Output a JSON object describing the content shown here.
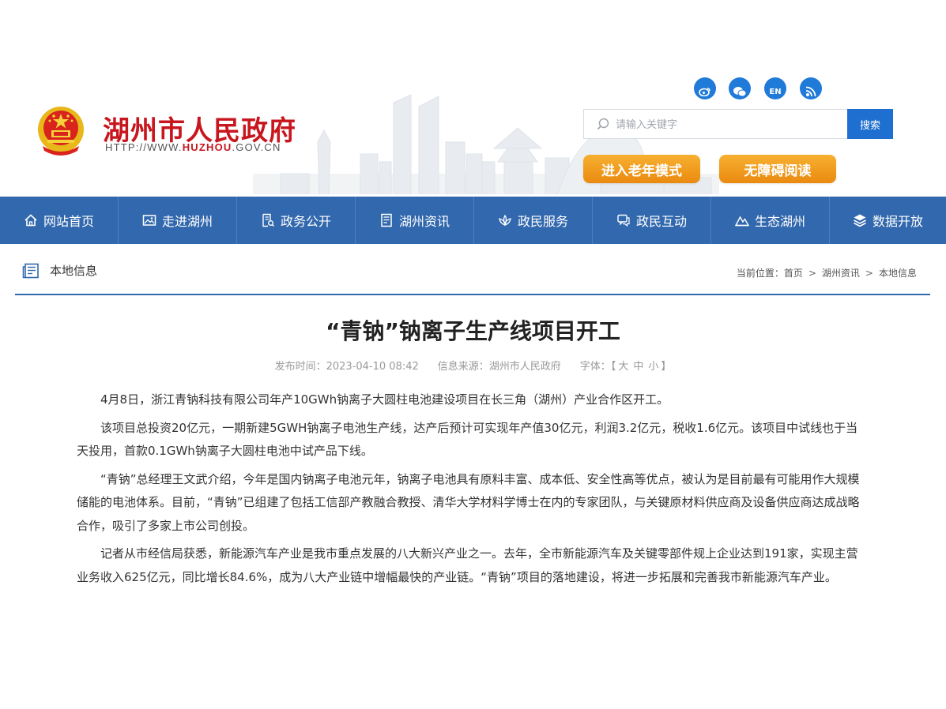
{
  "header": {
    "site_title": "湖州市人民政府",
    "url_prefix": "HTTP://WWW.",
    "url_domain": "HUZHOU",
    "url_suffix": ".GOV.CN",
    "social_icons": [
      "weibo-icon",
      "wechat-icon",
      "en-icon",
      "rss-icon"
    ],
    "en_label": "EN",
    "search": {
      "placeholder": "请输入关键字",
      "value": "",
      "button_label": "搜索"
    },
    "elder_mode_label": "进入老年模式",
    "accessible_label": "无障碍阅读",
    "colors": {
      "brand_red": "#c8161e",
      "accent_orange": "#f29a1f",
      "search_blue": "#1e6fd0"
    }
  },
  "nav": {
    "background": "#3268ad",
    "items": [
      {
        "label": "网站首页",
        "icon": "home-icon"
      },
      {
        "label": "走进湖州",
        "icon": "image-icon"
      },
      {
        "label": "政务公开",
        "icon": "document-search-icon"
      },
      {
        "label": "湖州资讯",
        "icon": "news-icon"
      },
      {
        "label": "政民服务",
        "icon": "lotus-icon"
      },
      {
        "label": "政民互动",
        "icon": "chat-icon"
      },
      {
        "label": "生态湖州",
        "icon": "mountain-icon"
      },
      {
        "label": "数据开放",
        "icon": "layers-icon"
      }
    ]
  },
  "section": {
    "title": "本地信息",
    "breadcrumb_label": "当前位置：",
    "breadcrumb": [
      "首页",
      "湖州资讯",
      "本地信息"
    ],
    "breadcrumb_sep": ">"
  },
  "article": {
    "title": "“青钠”钠离子生产线项目开工",
    "publish_label": "发布时间：",
    "publish_time": "2023-04-10 08:42",
    "source_label": "信息来源：",
    "source": "湖州市人民政府",
    "font_label": "字体：",
    "font_open": "【",
    "font_large": "大",
    "font_medium": "中",
    "font_small": "小",
    "font_close": "】",
    "paragraphs": [
      "4月8日，浙江青钠科技有限公司年产10GWh钠离子大圆柱电池建设项目在长三角（湖州）产业合作区开工。",
      "该项目总投资20亿元，一期新建5GWH钠离子电池生产线，达产后预计可实现年产值30亿元，利润3.2亿元，税收1.6亿元。该项目中试线也于当天投用，首款0.1GWh钠离子大圆柱电池中试产品下线。",
      "“青钠”总经理王文武介绍，今年是国内钠离子电池元年，钠离子电池具有原料丰富、成本低、安全性高等优点，被认为是目前最有可能用作大规模储能的电池体系。目前，“青钠”已组建了包括工信部产教融合教授、清华大学材料学博士在内的专家团队，与关键原材料供应商及设备供应商达成战略合作，吸引了多家上市公司创投。",
      "记者从市经信局获悉，新能源汽车产业是我市重点发展的八大新兴产业之一。去年，全市新能源汽车及关键零部件规上企业达到191家，实现主营业务收入625亿元，同比增长84.6%，成为八大产业链中增幅最快的产业链。“青钠”项目的落地建设，将进一步拓展和完善我市新能源汽车产业。"
    ]
  }
}
